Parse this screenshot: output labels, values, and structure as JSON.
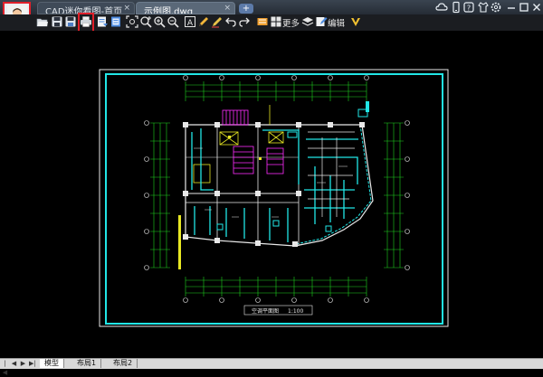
{
  "window": {
    "tabs": [
      {
        "label": "CAD迷你看图-首页",
        "close": "×"
      },
      {
        "label": "示例图.dwg",
        "close": "×"
      }
    ],
    "new_tab": "+",
    "controls": [
      "cloud-icon",
      "phone-icon",
      "help-icon",
      "skin-icon",
      "settings-icon",
      "minimize-icon",
      "maximize-icon",
      "close-icon"
    ]
  },
  "toolbar": {
    "more_label": "更多",
    "edit_label": "编辑"
  },
  "drawing": {
    "caption": "空调平面图",
    "scale": "1:100"
  },
  "layout_tabs": [
    "模型",
    "布局1",
    "布局2"
  ],
  "colors": {
    "frame": "#21e6e6",
    "white_line": "#e8e8e8",
    "green": "#1ed21e",
    "magenta": "#ff2cff",
    "yellow": "#e8e823",
    "highlight": "#e0202a"
  }
}
